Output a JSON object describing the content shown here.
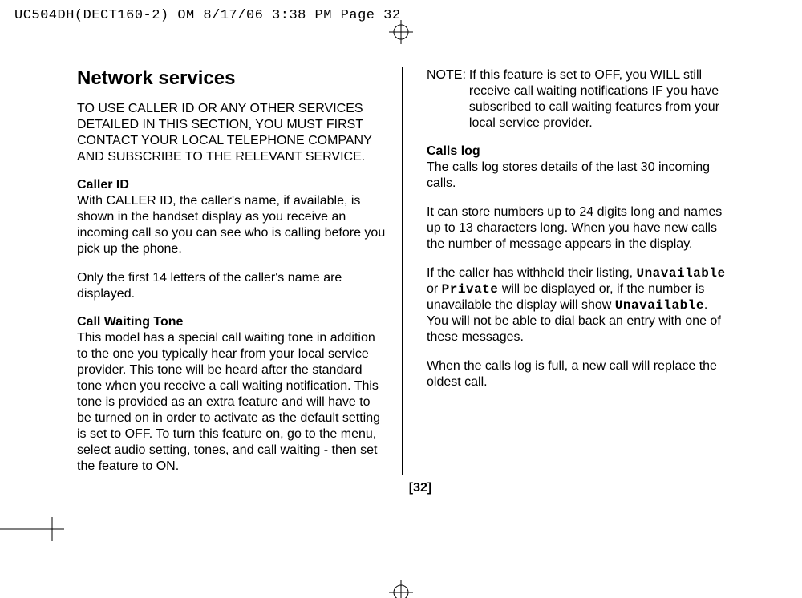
{
  "printHeader": "UC504DH(DECT160-2) OM  8/17/06  3:38 PM  Page 32",
  "left": {
    "title": "Network services",
    "intro": "TO USE CALLER ID OR ANY OTHER SERVICES DETAILED IN THIS SECTION, YOU MUST FIRST CONTACT YOUR LOCAL TELEPHONE COMPANY AND SUBSCRIBE TO THE RELEVANT SERVICE.",
    "callerIdHeading": "Caller ID",
    "callerIdPara1": "With CALLER ID, the caller's name, if available, is shown in the handset display as you receive an incoming call so you can see who is calling before you pick up the phone.",
    "callerIdPara2": "Only the first 14 letters of the caller's name are displayed.",
    "callWaitingHeading": "Call Waiting Tone",
    "callWaitingPara": "This model has a special call waiting tone in addition to the one you typically hear from your local service provider. This tone will be heard after the standard tone when you receive a call waiting notification. This tone is provided as an extra feature and will have to be turned on in order to activate as the default setting is set to OFF. To turn this feature on, go to the menu, select audio setting, tones, and call waiting - then set the feature to ON."
  },
  "right": {
    "noteLabel": "NOTE:",
    "noteText": "If this feature is set to OFF, you WILL still receive call waiting notifications IF you have subscribed to call waiting features from your local service provider.",
    "callsLogHeading": "Calls log",
    "callsLogPara1": "The calls log stores details of the last 30 incoming calls.",
    "callsLogPara2": "It can store numbers up to 24 digits long and names up to 13 characters long. When you have new calls the number of message appears in the display.",
    "withheld_pre": "If the caller has withheld their listing, ",
    "mono1": "Unavailable",
    "withheld_mid1": " or ",
    "mono2": "Private",
    "withheld_mid2": " will be displayed or, if the number is unavailable the display will show ",
    "mono3": "Unavailable",
    "withheld_post": ". You will not be able to dial back an entry with one of these messages.",
    "fullPara": "When the calls log is full, a new call will replace the oldest call."
  },
  "pageNumber": "[32]"
}
